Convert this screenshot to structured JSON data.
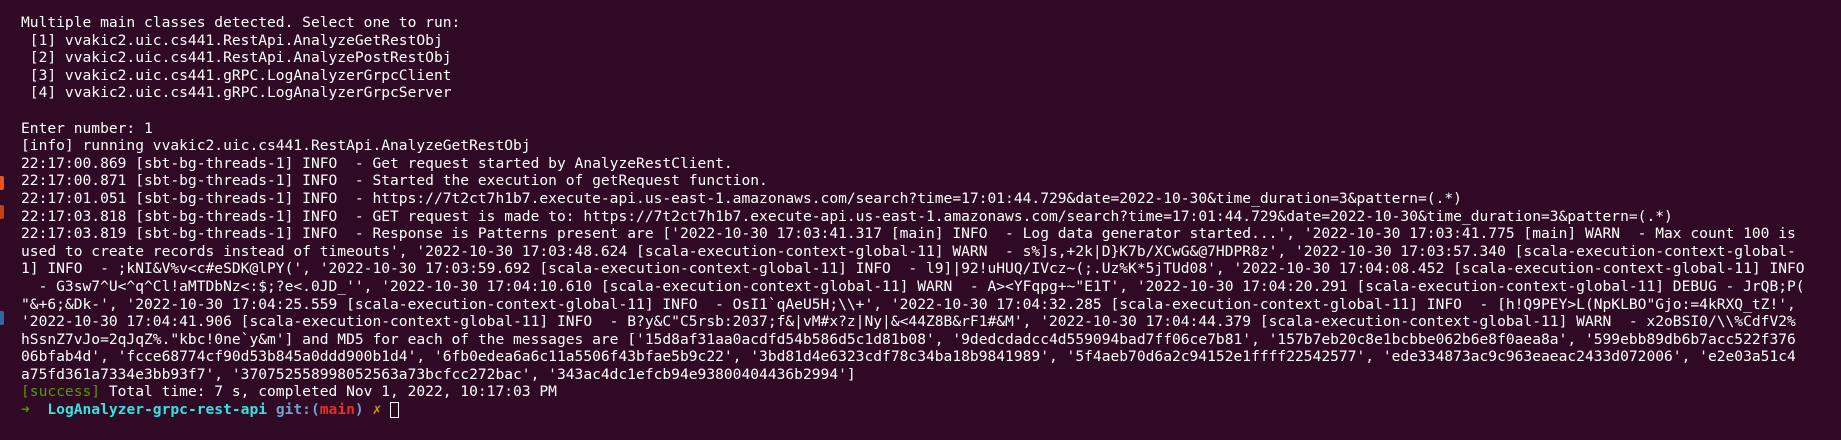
{
  "colors": {
    "background": "#300a24",
    "text": "#ffffff",
    "prompt_arrow": "#4e9a06",
    "prompt_dir": "#34e2e2",
    "prompt_git": "#729fcf",
    "prompt_branch": "#ef2929",
    "prompt_dirty": "#c4a000",
    "success": "#4e9a06"
  },
  "terminal": {
    "header": "Multiple main classes detected. Select one to run:",
    "options": [
      " [1] vvakic2.uic.cs441.RestApi.AnalyzeGetRestObj",
      " [2] vvakic2.uic.cs441.RestApi.AnalyzePostRestObj",
      " [3] vvakic2.uic.cs441.gRPC.LogAnalyzerGrpcClient",
      " [4] vvakic2.uic.cs441.gRPC.LogAnalyzerGrpcServer"
    ],
    "enter_number": "Enter number: 1",
    "running": "[info] running vvakic2.uic.cs441.RestApi.AnalyzeGetRestObj",
    "log_lines": [
      "22:17:00.869 [sbt-bg-threads-1] INFO  - Get request started by AnalyzeRestClient.",
      "22:17:00.871 [sbt-bg-threads-1] INFO  - Started the execution of getRequest function.",
      "22:17:01.051 [sbt-bg-threads-1] INFO  - https://7t2ct7h1b7.execute-api.us-east-1.amazonaws.com/search?time=17:01:44.729&date=2022-10-30&time_duration=3&pattern=(.*)",
      "22:17:03.818 [sbt-bg-threads-1] INFO  - GET request is made to: https://7t2ct7h1b7.execute-api.us-east-1.amazonaws.com/search?time=17:01:44.729&date=2022-10-30&time_duration=3&pattern=(.*)",
      "22:17:03.819 [sbt-bg-threads-1] INFO  - Response is Patterns present are ['2022-10-30 17:03:41.317 [main] INFO  - Log data generator started...', '2022-10-30 17:03:41.775 [main] WARN  - Max count 100 is",
      "used to create records instead of timeouts', '2022-10-30 17:03:48.624 [scala-execution-context-global-11] WARN  - s%]s,+2k|D}K7b/XCwG&@7HDPR8z', '2022-10-30 17:03:57.340 [scala-execution-context-global-",
      "1] INFO  - ;kNI&V%v<c#eSDK@lPY(', '2022-10-30 17:03:59.692 [scala-execution-context-global-11] INFO  - l9]|92!uHUQ/IVcz~(;.Uz%K*5jTUd08', '2022-10-30 17:04:08.452 [scala-execution-context-global-11] INFO",
      "  - G3sw7^U<^q^Cl!aMTDbNz<:$;?e<.0JD_'', '2022-10-30 17:04:10.610 [scala-execution-context-global-11] WARN  - A><YFqpg+~\"E1T', '2022-10-30 17:04:20.291 [scala-execution-context-global-11] DEBUG - JrQB;P(",
      "\"&+6;&Dk-', '2022-10-30 17:04:25.559 [scala-execution-context-global-11] INFO  - OsI1`qAeU5H;\\\\+', '2022-10-30 17:04:32.285 [scala-execution-context-global-11] INFO  - [h!Q9PEY>L(NpKLBO\"Gjo:=4kRXQ_tZ!',",
      "'2022-10-30 17:04:41.906 [scala-execution-context-global-11] INFO  - B?y&C\"C5rsb:2037;f&|vM#x?z|Ny|&<44Z8B&rF1#&M', '2022-10-30 17:04:44.379 [scala-execution-context-global-11] WARN  - x2oBSI0/\\\\%CdfV2%",
      "hSsnZ7vJo=2qJqZ%.\"kbc!0ne`y&m'] and MD5 for each of the messages are ['15d8af31aa0acdfd54b586d5c1d81b08', '9dedcdadcc4d559094bad7ff06ce7b81', '157b7eb20c8e1bcbbe062b6e8f0aea8a', '599ebb89db6b7acc522f376",
      "06bfab4d', 'fcce68774cf90d53b845a0ddd900b1d4', '6fb0edea6a6c11a5506f43bfae5b9c22', '3bd81d4e6323cdf78c34ba18b9841989', '5f4aeb70d6a2c94152e1ffff22542577', 'ede334873ac9c963eaeac2433d072006', 'e2e03a51c4",
      "a75fd361a7334e3bb93f7', '370752558998052563a73bcfcc272bac', '343ac4dc1efcb94e93800404436b2994']"
    ],
    "success_tag": "[success]",
    "success_text": " Total time: 7 s, completed Nov 1, 2022, 10:17:03 PM",
    "prompt": {
      "arrow": "➜",
      "directory": "LogAnalyzer-grpc-rest-api",
      "git_label": "git:(",
      "branch": "main",
      "git_close": ")",
      "dirty_mark": "✗"
    }
  },
  "dock": {
    "marks": [
      {
        "color": "#e95420"
      },
      {
        "color": "#c34113"
      },
      {
        "color": "#3465a4"
      }
    ]
  }
}
